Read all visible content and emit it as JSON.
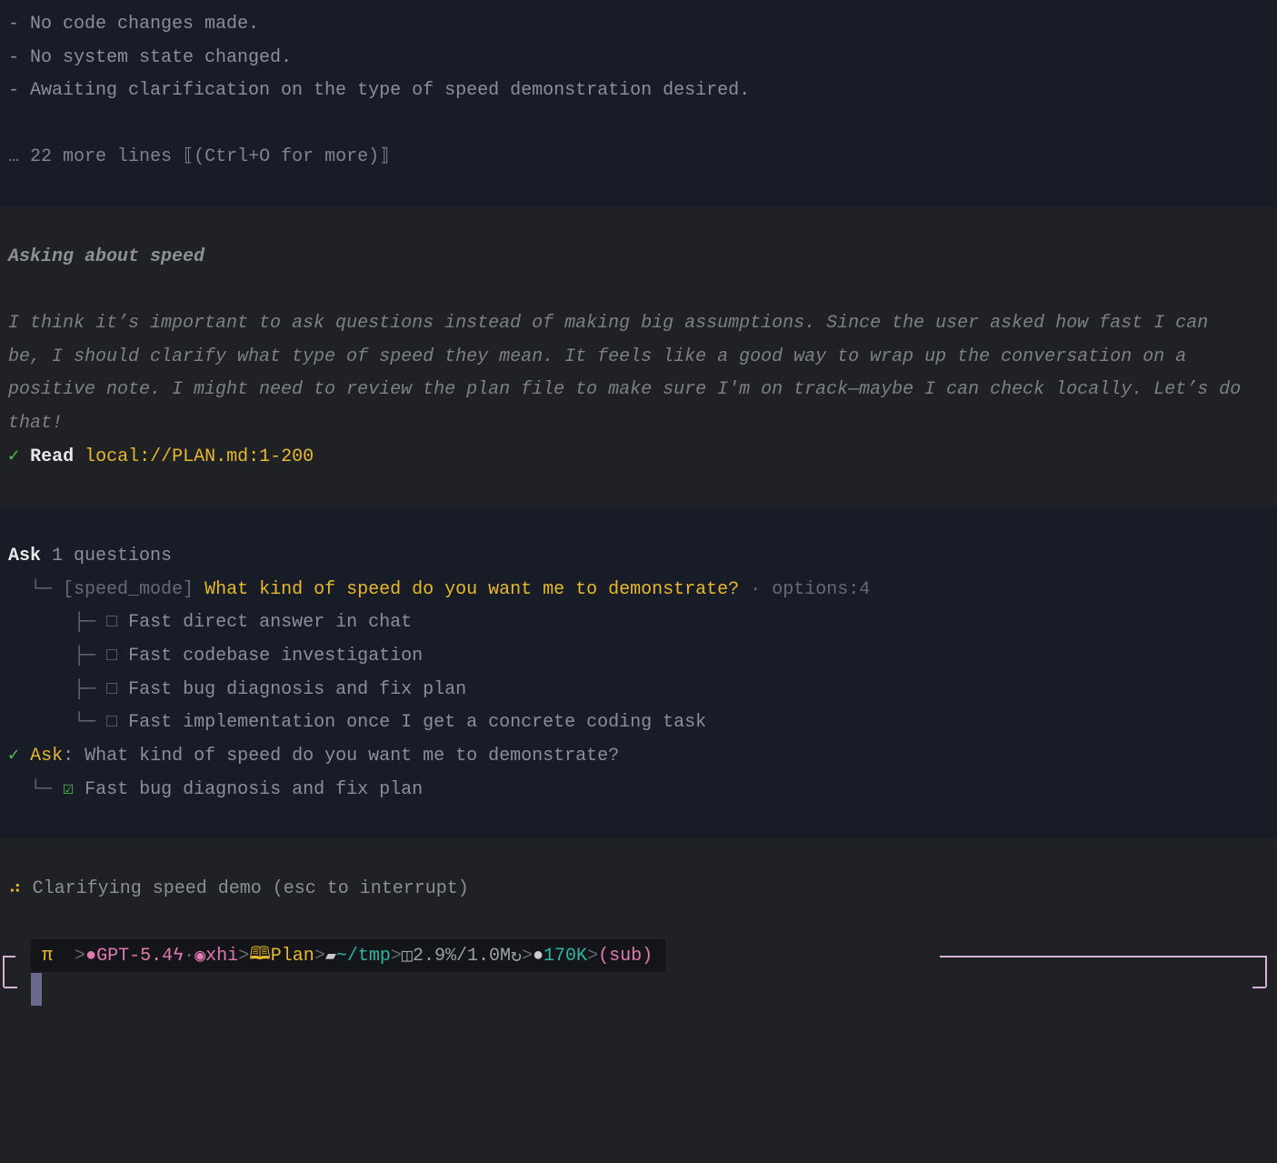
{
  "summary": {
    "lines": [
      "- No code changes made.",
      "- No system state changed.",
      "- Awaiting clarification on the type of speed demonstration desired."
    ],
    "more": "… 22 more lines ⟦(Ctrl+O for more)⟧"
  },
  "thinking": {
    "title": "Asking about speed",
    "lines": [
      "I think it’s important to ask questions instead of making big assumptions. Since the user asked how fast I can",
      "be, I should clarify what type of speed they mean. It feels like a good way to wrap up the conversation on a",
      "positive note. I might need to review the plan file to make sure I'm on track—maybe I can check locally. Let’s do",
      "that!"
    ]
  },
  "read": {
    "check": "✓",
    "label": "Read",
    "path": "local://PLAN.md:1-200"
  },
  "ask": {
    "label": "Ask",
    "count": "1 questions",
    "id": "[speed_mode]",
    "question": "What kind of speed do you want me to demonstrate?",
    "meta": "· options:4",
    "options": [
      "Fast direct answer in chat",
      "Fast codebase investigation",
      "Fast bug diagnosis and fix plan",
      "Fast implementation once I get a concrete coding task"
    ],
    "result_label": "Ask",
    "result_question": "What kind of speed do you want me to demonstrate?",
    "answer": "Fast bug diagnosis and fix plan"
  },
  "working": {
    "spinner": "⠴",
    "text": "Clarifying speed demo (esc to interrupt)"
  },
  "status": {
    "pi": "π",
    "model": "GPT-5.4",
    "effort": "xhi",
    "mode": "Plan",
    "dir": "~/tmp",
    "context": "2.9%/1.0M",
    "tokens": "170K",
    "sub": "(sub)",
    "sep": ">"
  },
  "colors": {
    "accent": "#e8b92c",
    "success": "#4cc24a",
    "pink": "#e07ab0",
    "teal": "#2fb5a5",
    "border": "#d9b3d3"
  }
}
